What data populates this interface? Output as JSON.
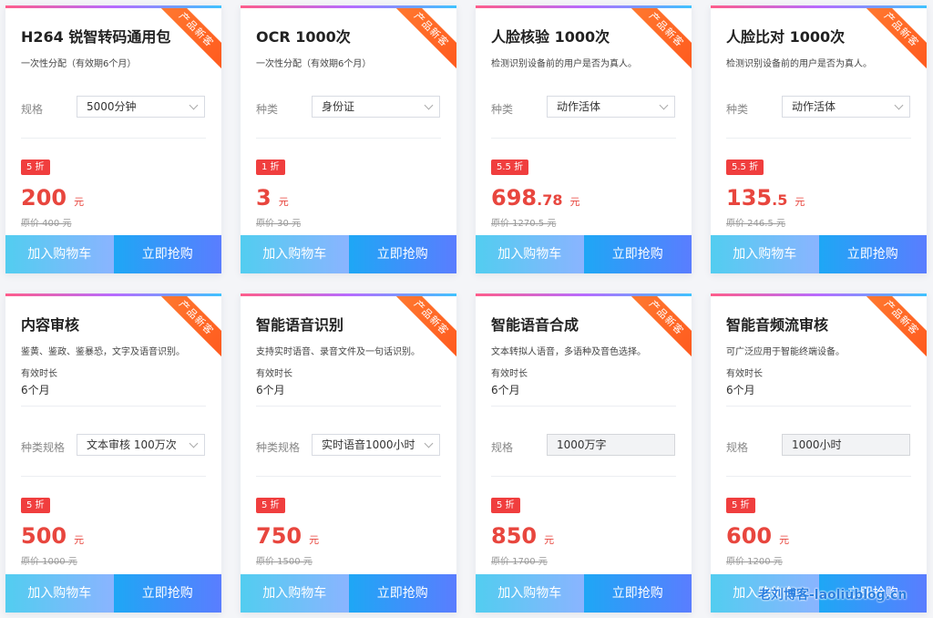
{
  "ribbon": "产品新客",
  "buttons": {
    "cart": "加入购物车",
    "buy": "立即抢购"
  },
  "price_unit": "元",
  "valid_label": "有效时长",
  "cards": [
    {
      "title": "H264 锐智转码通用包",
      "desc": "一次性分配（有效期6个月）",
      "spec_label": "规格",
      "spec_value": "5000分钟",
      "discount": "5 折",
      "price_int": "200",
      "price_dec": "",
      "orig": "原价 400 元"
    },
    {
      "title": "OCR 1000次",
      "desc": "一次性分配（有效期6个月）",
      "spec_label": "种类",
      "spec_value": "身份证",
      "discount": "1 折",
      "price_int": "3",
      "price_dec": "",
      "orig": "原价 30 元"
    },
    {
      "title": "人脸核验 1000次",
      "desc": "检测识别设备前的用户是否为真人。",
      "spec_label": "种类",
      "spec_value": "动作活体",
      "discount": "5.5 折",
      "price_int": "698",
      "price_dec": ".78",
      "orig": "原价 1270.5 元"
    },
    {
      "title": "人脸比对 1000次",
      "desc": "检测识别设备前的用户是否为真人。",
      "spec_label": "种类",
      "spec_value": "动作活体",
      "discount": "5.5 折",
      "price_int": "135",
      "price_dec": ".5",
      "orig": "原价 246.5 元"
    },
    {
      "title": "内容审核",
      "desc": "鉴黄、鉴政、鉴暴恐，文字及语音识别。",
      "valid_value": "6个月",
      "spec_label": "种类规格",
      "spec_value": "文本审核 100万次",
      "discount": "5 折",
      "price_int": "500",
      "price_dec": "",
      "orig": "原价 1000 元"
    },
    {
      "title": "智能语音识别",
      "desc": "支持实时语音、录音文件及一句话识别。",
      "valid_value": "6个月",
      "spec_label": "种类规格",
      "spec_value": "实时语音1000小时",
      "discount": "5 折",
      "price_int": "750",
      "price_dec": "",
      "orig": "原价 1500 元"
    },
    {
      "title": "智能语音合成",
      "desc": "文本转拟人语音，多语种及音色选择。",
      "valid_value": "6个月",
      "spec_label": "规格",
      "spec_value": "1000万字",
      "discount": "5 折",
      "price_int": "850",
      "price_dec": "",
      "orig": "原价 1700 元"
    },
    {
      "title": "智能音频流审核",
      "desc": "可广泛应用于智能终端设备。",
      "valid_value": "6个月",
      "spec_label": "规格",
      "spec_value": "1000小时",
      "discount": "5 折",
      "price_int": "600",
      "price_dec": "",
      "orig": "原价 1200 元"
    }
  ],
  "watermark": "老刘博客-laoliublog.cn"
}
